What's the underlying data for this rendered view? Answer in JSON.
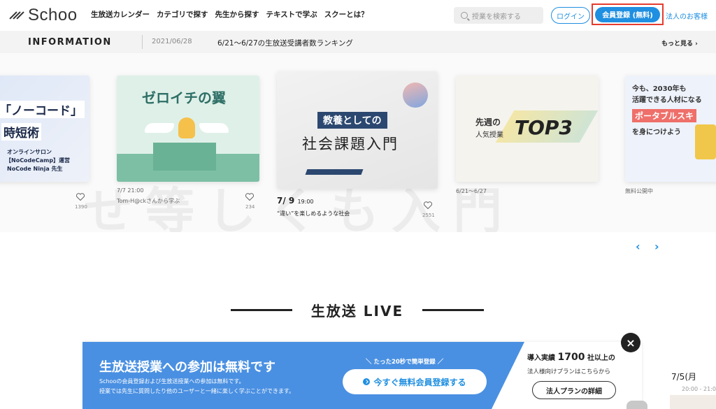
{
  "header": {
    "logo": "Schoo",
    "nav": [
      "生放送カレンダー",
      "カテゴリで探す",
      "先生から探す",
      "テキストで学ぶ",
      "スクーとは？"
    ],
    "search_placeholder": "授業を検索する",
    "login_label": "ログイン",
    "register_label": "会員登録 (無料)",
    "corp_label": "法人のお客様"
  },
  "info": {
    "title": "INFORMATION",
    "date": "2021/06/28",
    "text": "6/21〜6/27の生放送受講者数ランキング",
    "more": "もっと見る ›"
  },
  "carousel": {
    "bg_text": "せ等しくも入門",
    "cards": [
      {
        "line1": "「ノーコード」",
        "line2": "時短術",
        "line3": "オンラインサロン",
        "line4": "【NoCodeCamp】運営",
        "line5": "NoCode Ninja 先生",
        "count": "1390"
      },
      {
        "title": "ゼロイチの翼",
        "meta1": "7/7 21:00",
        "meta2": "Tom-H@ckさんから学ぶ",
        "count": "234"
      },
      {
        "title_top": "教養としての",
        "title_main": "社会課題入門",
        "meta_date": "7/ 9",
        "meta_time": "19:00",
        "meta_sub": "“違い”を楽しめるような社会",
        "count": "2551"
      },
      {
        "t1": "先週の",
        "t2": "人気授業",
        "t3": "TOP3",
        "meta": "6/21〜6/27"
      },
      {
        "l1": "今も、2030年も",
        "l2": "活躍できる人材になる",
        "l3": "ポータブルスキ",
        "l4": "を身につけよう",
        "meta": "無料公開中"
      }
    ],
    "prev_arrow": "‹",
    "next_arrow": "›"
  },
  "section": {
    "title": "生放送 LIVE"
  },
  "banner": {
    "title": "生放送授業への参加は無料です",
    "sub1": "Schooの会員登録および生放送授業への参加は無料です。",
    "sub2": "授業では先生に質問したり他のユーザーと一緒に楽しく学ぶことができます。",
    "tag": "＼ たった20秒で簡単登録 ／",
    "cta": "今すぐ無料会員登録する",
    "corp_line1_pre": "導入実績",
    "corp_line1_num": "1700",
    "corp_line1_post": "社以上の",
    "corp_line2": "法人様向けプランはこちらから",
    "corp_button": "法人プランの詳細",
    "close": "×"
  },
  "side": {
    "date": "7/5(月",
    "time": "20:00 - 21:0"
  },
  "colors": {
    "accent": "#1f8fe1",
    "banner_blue": "#4a90e2",
    "highlight_red": "#e63b2e"
  }
}
